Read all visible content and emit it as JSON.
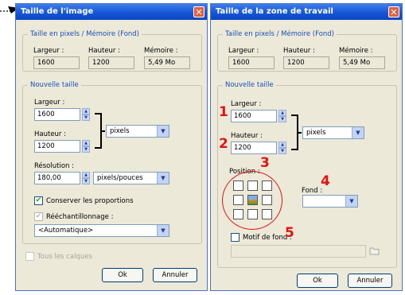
{
  "left_dialog": {
    "title": "Taille de l'image",
    "group1": "Taille en pixels / Mémoire (Fond)",
    "width_label": "Largeur :",
    "height_label": "Hauteur :",
    "memory_label": "Mémoire :",
    "width_value": "1600",
    "height_value": "1200",
    "memory_value": "5,49 Mo",
    "group2": "Nouvelle taille",
    "new_width_label": "Largeur :",
    "new_width_value": "1600",
    "new_height_label": "Hauteur :",
    "new_height_value": "1200",
    "unit_select": "pixels",
    "resolution_label": "Résolution :",
    "resolution_value": "180,00",
    "resolution_unit": "pixels/pouces",
    "keep_proportions": "Conserver les proportions",
    "resample": "Rééchantillonnage :",
    "resample_method": "<Automatique>",
    "all_layers": "Tous les calques",
    "ok": "Ok",
    "cancel": "Annuler"
  },
  "right_dialog": {
    "title": "Taille de la zone de travail",
    "group1": "Taille en pixels / Mémoire (Fond)",
    "width_label": "Largeur :",
    "height_label": "Hauteur :",
    "memory_label": "Mémoire :",
    "width_value": "1600",
    "height_value": "1200",
    "memory_value": "5,49 Mo",
    "group2": "Nouvelle taille",
    "new_width_label": "Largeur :",
    "new_width_value": "1600",
    "new_height_label": "Hauteur :",
    "new_height_value": "1200",
    "unit_select": "pixels",
    "position_label": "Position :",
    "background_label": "Fond :",
    "pattern_label": "Motif de fond :",
    "ok": "Ok",
    "cancel": "Annuler"
  },
  "annotations": [
    "1",
    "2",
    "3",
    "4",
    "5"
  ],
  "colors": {
    "title_bar": "#1656d6",
    "annotation": "#e31212",
    "dialog_bg": "#ece9d8"
  }
}
